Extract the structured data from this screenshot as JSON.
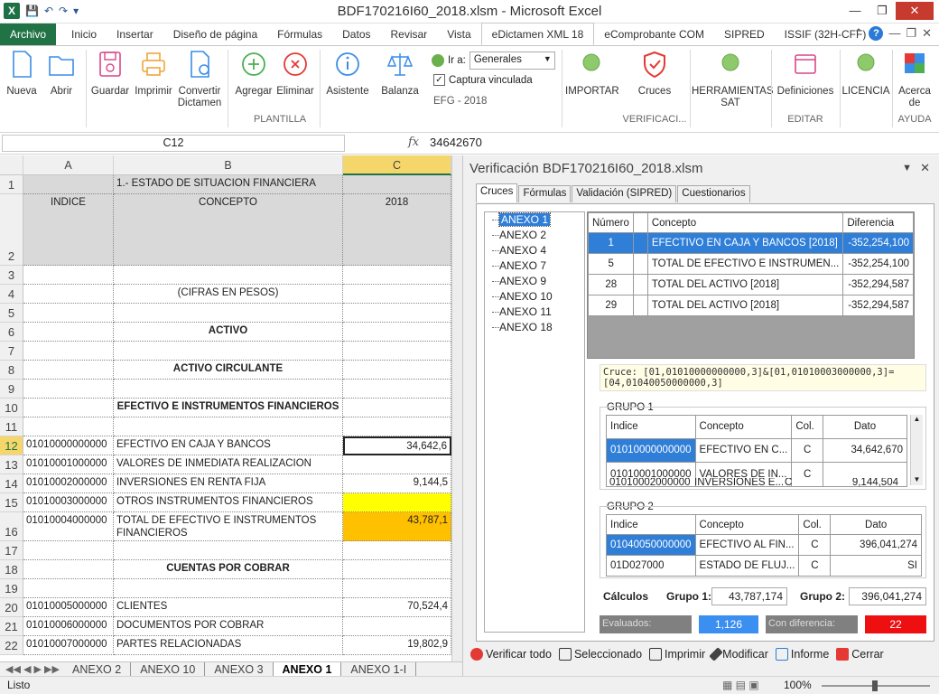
{
  "window": {
    "title": "BDF170216I60_2018.xlsm - Microsoft Excel"
  },
  "ribbon_tabs": [
    "Archivo",
    "Inicio",
    "Insertar",
    "Diseño de página",
    "Fórmulas",
    "Datos",
    "Revisar",
    "Vista",
    "eDictamen XML 18",
    "eComprobante COM",
    "SIPRED",
    "ISSIF (32H-CFF)"
  ],
  "ribbon": {
    "nueva": "Nueva",
    "abrir": "Abrir",
    "guardar": "Guardar",
    "imprimir": "Imprimir",
    "convertir": "Convertir Dictamen",
    "agregar": "Agregar",
    "eliminar": "Eliminar",
    "asistente": "Asistente",
    "balanza": "Balanza",
    "ir_a_label": "Ir a:",
    "ir_a_value": "Generales",
    "captura": "Captura vinculada",
    "efg": "EFG - 2018",
    "plantilla": "PLANTILLA",
    "importar": "IMPORTAR",
    "cruces": "Cruces",
    "verificaci": "VERIFICACI...",
    "herramientas": "HERRAMIENTAS SAT",
    "definiciones": "Definiciones",
    "editar": "EDITAR",
    "licencia": "LICENCIA",
    "acerca": "Acerca de",
    "ayuda": "AYUDA"
  },
  "formula_bar": {
    "name_box": "C12",
    "fx": "fx",
    "value": "34642670"
  },
  "grid": {
    "columns": [
      "A",
      "B",
      "C"
    ],
    "rows": [
      {
        "n": "1",
        "a": "",
        "b": "1.- ESTADO DE SITUACION FINANCIERA",
        "c": ""
      },
      {
        "n": "2",
        "a": "INDICE",
        "b": "CONCEPTO",
        "c": "2018"
      },
      {
        "n": "3",
        "a": "",
        "b": "",
        "c": ""
      },
      {
        "n": "4",
        "a": "",
        "b": "(CIFRAS EN PESOS)",
        "c": ""
      },
      {
        "n": "5",
        "a": "",
        "b": "",
        "c": ""
      },
      {
        "n": "6",
        "a": "",
        "b": "ACTIVO",
        "c": ""
      },
      {
        "n": "7",
        "a": "",
        "b": "",
        "c": ""
      },
      {
        "n": "8",
        "a": "",
        "b": "ACTIVO CIRCULANTE",
        "c": ""
      },
      {
        "n": "9",
        "a": "",
        "b": "",
        "c": ""
      },
      {
        "n": "10",
        "a": "",
        "b": "EFECTIVO E INSTRUMENTOS FINANCIEROS",
        "c": ""
      },
      {
        "n": "11",
        "a": "",
        "b": "",
        "c": ""
      },
      {
        "n": "12",
        "a": "01010000000000",
        "b": "EFECTIVO EN CAJA Y BANCOS",
        "c": "34,642,6"
      },
      {
        "n": "13",
        "a": "01010001000000",
        "b": "VALORES DE INMEDIATA REALIZACION",
        "c": ""
      },
      {
        "n": "14",
        "a": "01010002000000",
        "b": "INVERSIONES EN RENTA FIJA",
        "c": "9,144,5"
      },
      {
        "n": "15",
        "a": "01010003000000",
        "b": "OTROS INSTRUMENTOS FINANCIEROS",
        "c": ""
      },
      {
        "n": "16",
        "a": "01010004000000",
        "b": "TOTAL DE EFECTIVO E INSTRUMENTOS",
        "b2": "FINANCIEROS",
        "c": "43,787,1"
      },
      {
        "n": "17",
        "a": "",
        "b": "",
        "c": ""
      },
      {
        "n": "18",
        "a": "",
        "b": "CUENTAS POR COBRAR",
        "c": ""
      },
      {
        "n": "19",
        "a": "",
        "b": "",
        "c": ""
      },
      {
        "n": "20",
        "a": "01010005000000",
        "b": "CLIENTES",
        "c": "70,524,4"
      },
      {
        "n": "21",
        "a": "01010006000000",
        "b": "DOCUMENTOS POR COBRAR",
        "c": ""
      },
      {
        "n": "22",
        "a": "01010007000000",
        "b": "PARTES RELACIONADAS",
        "c": "19,802,9"
      }
    ]
  },
  "sheet_tabs": [
    "ANEXO 2",
    "ANEXO 10",
    "ANEXO 3",
    "ANEXO 1",
    "ANEXO 1-I"
  ],
  "status": {
    "ready": "Listo",
    "zoom": "100%"
  },
  "panel": {
    "title": "Verificación BDF170216I60_2018.xlsm",
    "tabs": [
      "Cruces",
      "Fórmulas",
      "Validación (SIPRED)",
      "Cuestionarios"
    ],
    "tree": [
      "ANEXO 1",
      "ANEXO 2",
      "ANEXO 4",
      "ANEXO 7",
      "ANEXO 9",
      "ANEXO 10",
      "ANEXO 11",
      "ANEXO 18"
    ],
    "cross_headers": [
      "Número",
      "",
      "Concepto",
      "Diferencia"
    ],
    "cross_rows": [
      {
        "num": "1",
        "concepto": "EFECTIVO EN CAJA Y BANCOS [2018]",
        "dif": "-352,254,100"
      },
      {
        "num": "5",
        "concepto": "TOTAL DE EFECTIVO E INSTRUMEN...",
        "dif": "-352,254,100"
      },
      {
        "num": "28",
        "concepto": "TOTAL DEL ACTIVO [2018]",
        "dif": "-352,294,587"
      },
      {
        "num": "29",
        "concepto": "TOTAL DEL ACTIVO [2018]",
        "dif": "-352,294,587"
      }
    ],
    "formula": "Cruce: [01,01010000000000,3]&[01,01010003000000,3]=[04,01040050000000,3]",
    "grupo1": {
      "label": "GRUPO 1",
      "headers": [
        "Indice",
        "Concepto",
        "Col.",
        "Dato"
      ],
      "rows": [
        {
          "i": "01010000000000",
          "c": "EFECTIVO EN C...",
          "col": "C",
          "d": "34,642,670"
        },
        {
          "i": "01010001000000",
          "c": "VALORES DE IN...",
          "col": "C",
          "d": ""
        },
        {
          "i": "01010002000000",
          "c": "INVERSIONES E...",
          "col": "C",
          "d": "9,144,504"
        }
      ]
    },
    "grupo2": {
      "label": "GRUPO 2",
      "headers": [
        "Indice",
        "Concepto",
        "Col.",
        "Dato"
      ],
      "rows": [
        {
          "i": "01040050000000",
          "c": "EFECTIVO AL FIN...",
          "col": "C",
          "d": "396,041,274"
        },
        {
          "i": "01D027000",
          "c": "ESTADO DE FLUJ...",
          "col": "C",
          "d": "SI"
        }
      ]
    },
    "calc": {
      "label": "Cálculos",
      "g1_label": "Grupo 1:",
      "g1": "43,787,174",
      "g2_label": "Grupo 2:",
      "g2": "396,041,274"
    },
    "evaluados_label": "Evaluados:",
    "evaluados": "1,126",
    "diferencia_label": "Con diferencia:",
    "diferencia": "22",
    "buttons": [
      "Verificar todo",
      "Seleccionado",
      "Imprimir",
      "Modificar",
      "Informe",
      "Cerrar"
    ]
  }
}
